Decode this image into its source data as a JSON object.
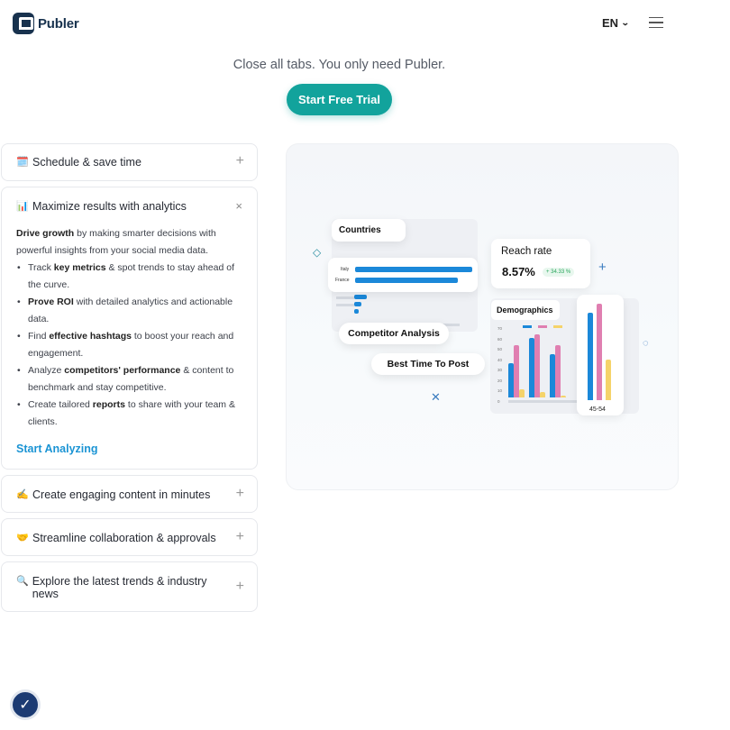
{
  "header": {
    "brand": "Publer",
    "language": "EN",
    "language_chevron": "⌄"
  },
  "hero": {
    "tagline": "Close all tabs. You only need Publer.",
    "cta": "Start Free Trial"
  },
  "accordion": [
    {
      "icon": "calendar-emoji",
      "emoji": "🗓️",
      "title": "Schedule & save time",
      "toggle": "+"
    },
    {
      "icon": "bar-chart-emoji",
      "emoji": "📊",
      "title": "Maximize results with analytics",
      "toggle": "×",
      "body": {
        "intro_bold": "Drive growth",
        "intro_rest": " by making smarter decisions with powerful insights from your social media data.",
        "bullets": [
          {
            "pre": "Track ",
            "bold": "key metrics",
            "post": " & spot trends to stay ahead of the curve."
          },
          {
            "pre": "",
            "bold": "Prove ROI",
            "post": " with detailed analytics and actionable data."
          },
          {
            "pre": "Find ",
            "bold": "effective hashtags",
            "post": " to boost your reach and engagement."
          },
          {
            "pre": "Analyze ",
            "bold": "competitors' performance",
            "post": " & content to benchmark and stay competitive."
          },
          {
            "pre": "Create tailored ",
            "bold": "reports",
            "post": " to share with your team & clients."
          }
        ],
        "link": "Start Analyzing"
      }
    },
    {
      "icon": "writing-hand-emoji",
      "emoji": "✍️",
      "title": "Create engaging content in minutes",
      "toggle": "+"
    },
    {
      "icon": "handshake-emoji",
      "emoji": "🤝",
      "title": "Streamline collaboration & approvals",
      "toggle": "+"
    },
    {
      "icon": "magnifier-emoji",
      "emoji": "🔍",
      "title": "Explore the latest trends & industry news",
      "toggle": "+"
    }
  ],
  "illustration": {
    "countries": {
      "title": "Countries",
      "rows": [
        {
          "label": "Italy",
          "value": 100
        },
        {
          "label": "France",
          "value": 88
        }
      ]
    },
    "reach": {
      "title": "Reach rate",
      "value": "8.57%",
      "badge": "+ 34.33 %"
    },
    "demographics": {
      "title": "Demographics",
      "age_label": "45-54",
      "y_ticks": [
        "70",
        "60",
        "50",
        "40",
        "30",
        "20",
        "10",
        "0"
      ],
      "series_colors": [
        "#1b88d9",
        "#e07fb1",
        "#f5d36a"
      ]
    },
    "pills": {
      "competitor": "Competitor Analysis",
      "best_time": "Best Time To Post"
    }
  },
  "accessibility": {
    "label": "accessibility-icon"
  }
}
